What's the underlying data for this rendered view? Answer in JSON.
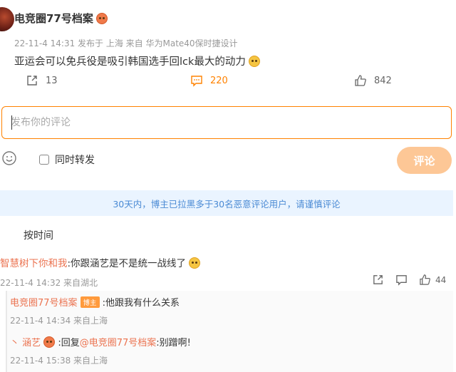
{
  "post": {
    "author": "电竞圈77号档案",
    "meta": "22-11-4 14:31  发布于 上海  来自 华为Mate40保时捷设计",
    "text": "亚运会可以免兵役是吸引韩国选手回lck最大的动力"
  },
  "actions": {
    "repost_count": "13",
    "comment_count": "220",
    "like_count": "842"
  },
  "composer": {
    "placeholder": "发布你的评论",
    "repost_label": "同时转发",
    "submit_label": "评论"
  },
  "notice": "30天内，博主已拉黑多于30名恶意评论用户，请谨慎评论",
  "sort_label": "按时间",
  "comments": [
    {
      "user": "智慧树下你和我",
      "text": ":你跟涵艺是不是统一战线了",
      "meta": "22-11-4 14:32 来自湖北",
      "like_count": "44",
      "replies": [
        {
          "user": "电竞圈77号档案",
          "badge": "博主",
          "text": ":他跟我有什么关系",
          "meta": "22-11-4 14:34 来自上海"
        },
        {
          "prefix": "丶",
          "user": "涵艺",
          "text_before": ":回复",
          "mention": "@电竞圈77号档案",
          "text_after": ":别蹭啊!",
          "meta": "22-11-4 15:38 来自上海"
        }
      ]
    }
  ],
  "colors": {
    "accent": "#ff8200",
    "username": "#eb7350",
    "notice_bg": "#eaf4ff",
    "notice_text": "#4a8ad4"
  }
}
